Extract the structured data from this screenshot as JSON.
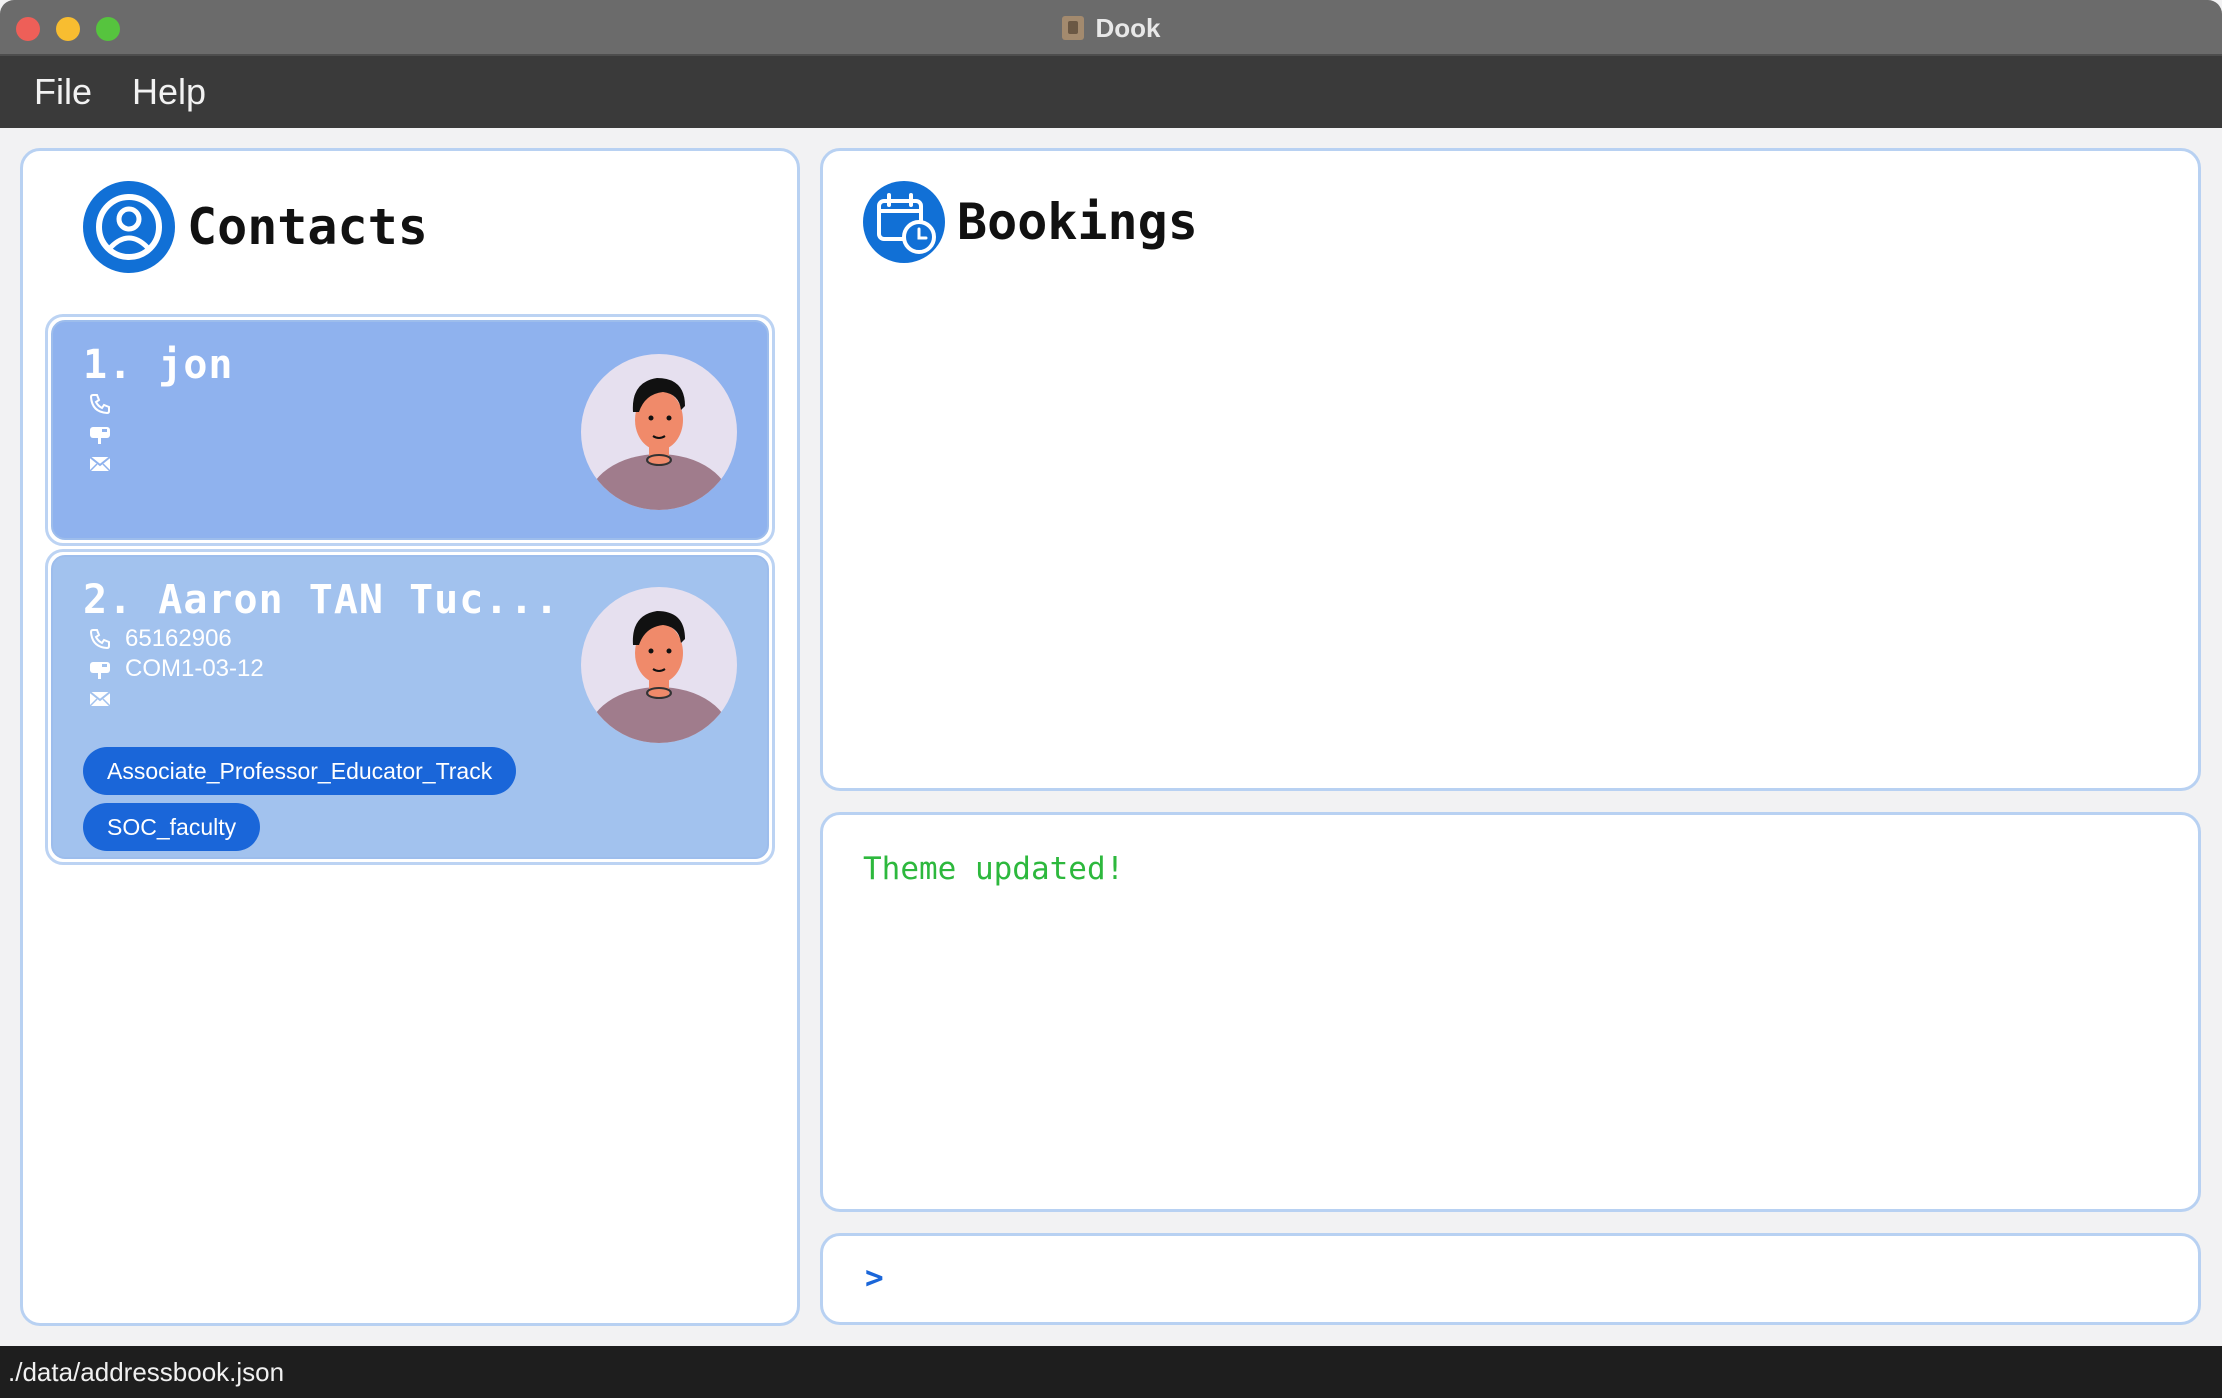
{
  "window": {
    "title": "Dook"
  },
  "menu": {
    "items": [
      "File",
      "Help"
    ]
  },
  "contacts": {
    "title": "Contacts",
    "list": [
      {
        "name": "1.  jon",
        "phone": "",
        "address": "",
        "email": "",
        "tags": []
      },
      {
        "name": "2.  Aaron TAN Tuc...",
        "phone": "65162906",
        "address": "COM1-03-12",
        "email": "",
        "tags": [
          "Associate_Professor_Educator_Track",
          "SOC_faculty"
        ]
      }
    ]
  },
  "bookings": {
    "title": "Bookings"
  },
  "result": {
    "message": "Theme updated!"
  },
  "command": {
    "prompt": ">",
    "value": ""
  },
  "status": {
    "path": "./data/addressbook.json"
  },
  "colors": {
    "accent": "#1170d6",
    "tag": "#1a66d9",
    "card1": "#8fb2ee",
    "card2": "#a2c2ee",
    "panel_border": "#b8d1f2",
    "success_text": "#2db83d"
  },
  "icons": {
    "contacts": "user-circle-icon",
    "bookings": "calendar-clock-icon",
    "phone": "phone-icon",
    "address": "mailbox-icon",
    "email": "envelope-icon"
  }
}
